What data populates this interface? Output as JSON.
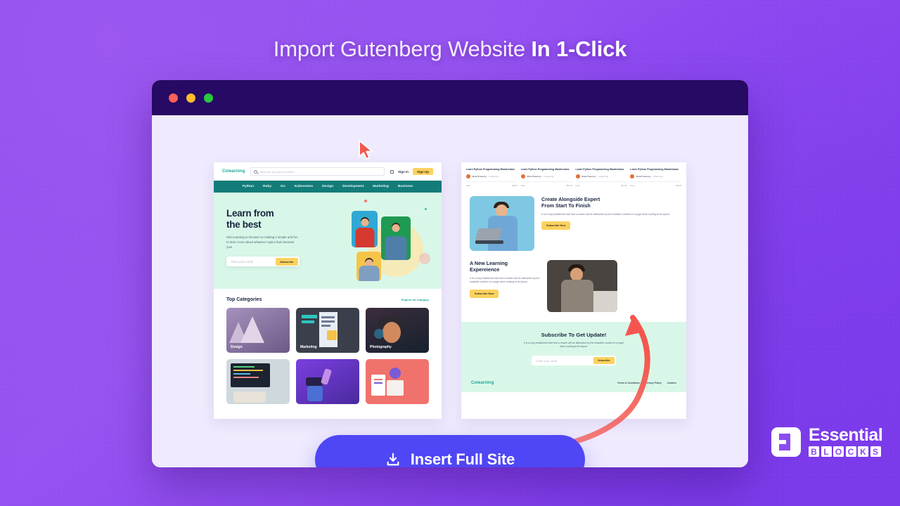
{
  "headline": {
    "light": "Import Gutenberg Website ",
    "bold": "In 1-Click"
  },
  "window": {
    "dots": [
      "close",
      "minimize",
      "maximize"
    ]
  },
  "left_site": {
    "logo": "Colearning",
    "search_placeholder": "What are you want to learn?",
    "sign_in": "Sign In",
    "sign_up": "Sign Up",
    "menu": [
      "Python",
      "Ruby",
      "Go",
      "Kubernetes",
      "Design",
      "Development",
      "Marketing",
      "Business"
    ],
    "hero": {
      "title_line1": "Learn from",
      "title_line2": "the best",
      "paragraph": "Owl Learning is focused on making it simple and fun to learn more about whatever topics that interests you!",
      "email_placeholder": "Enter your email",
      "button": "Subscribe"
    },
    "categories": {
      "title": "Top Categories",
      "link": "Explore All Category",
      "items": [
        {
          "label": "Design",
          "color": "#8e7aa8"
        },
        {
          "label": "Marketing",
          "color": "#3a3f4b"
        },
        {
          "label": "Photography",
          "color": "#2a2230"
        },
        {
          "label": "",
          "color": "#cfd8dd"
        },
        {
          "label": "",
          "color": "#6d3fd4"
        },
        {
          "label": "",
          "color": "#f0726d"
        }
      ]
    }
  },
  "right_site": {
    "courses": [
      {
        "title": "Learn Python Programming Masterclass",
        "author": "Brad Traversy",
        "brand": "Colearning",
        "level": "Free",
        "price": "$0.99"
      },
      {
        "title": "Learn Python Programming Masterclass",
        "author": "Brad Traversy",
        "brand": "Colearning",
        "level": "Free",
        "price": "$0.99"
      },
      {
        "title": "Learn Python Programming Masterclass",
        "author": "Brad Traversy",
        "brand": "Colearning",
        "level": "Free",
        "price": "$0.99"
      },
      {
        "title": "Learn Python Programming Masterclass",
        "author": "Brad Traversy",
        "brand": "Colearning",
        "level": "Free",
        "price": "$0.99"
      }
    ],
    "section_expert": {
      "title_line1": "Create Alongside Expert",
      "title_line2": "From Start To Finish",
      "paragraph": "It is a long established fact that a reader will be distracted by the readable content of a page when looking at its layout.",
      "button": "Subscribe Now"
    },
    "section_learning": {
      "title_line1": "A New Learning",
      "title_line2": "Expereience",
      "paragraph": "It is a long established fact that a reader will be distracted by the readable content of a page when looking at its layout.",
      "button": "Subscribe Now"
    },
    "subscribe": {
      "title": "Subscribe To Get Update!",
      "paragraph": "It is a long established fact that a reader will be distracted by the readable content of a page when looking at its layout.",
      "email_placeholder": "Enter your email",
      "button": "Subscribe"
    },
    "footer": {
      "logo": "Colearning",
      "links": [
        "Terms & Conditions",
        "Privacy Policy",
        "Cookies"
      ]
    }
  },
  "cta": {
    "label": "Insert Full Site",
    "icon": "download-icon",
    "color": "#4f46f5"
  },
  "brand": {
    "name_top": "Essential",
    "letters": [
      "B",
      "L",
      "O",
      "C",
      "K",
      "S"
    ],
    "color": "#8b4df0"
  }
}
